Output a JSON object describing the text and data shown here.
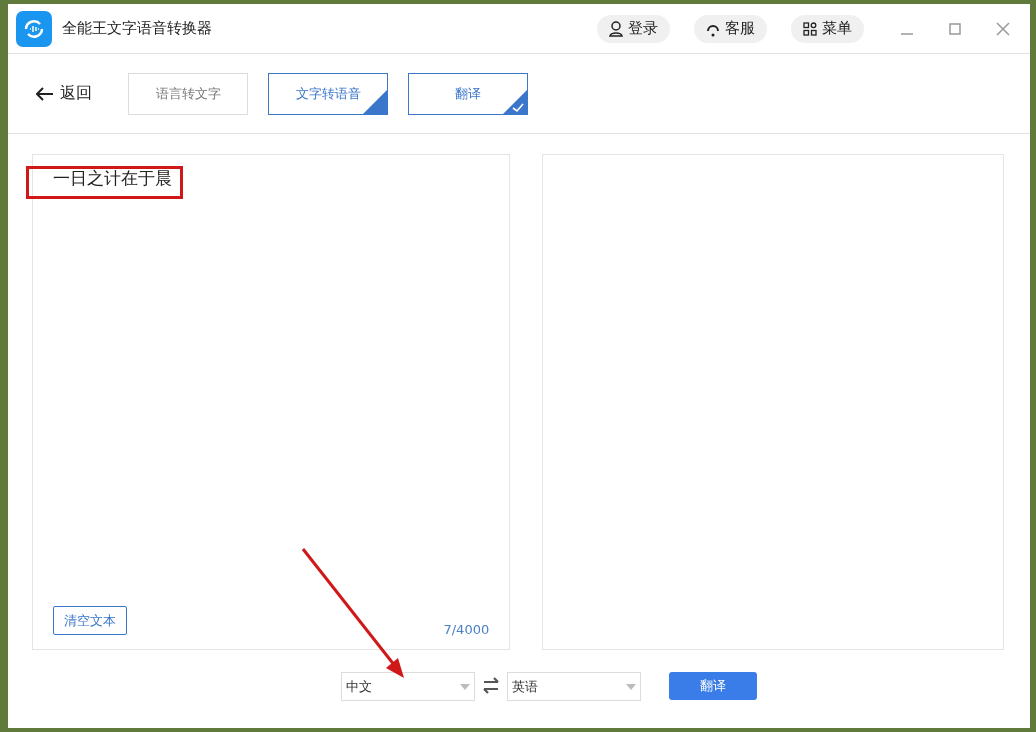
{
  "window": {
    "title": "全能王文字语音转换器"
  },
  "header_buttons": [
    {
      "kind": "user",
      "label": "登录"
    },
    {
      "kind": "headset",
      "label": "客服"
    },
    {
      "kind": "grid",
      "label": "菜单"
    }
  ],
  "back": {
    "label": "返回"
  },
  "tabs": [
    {
      "label": "语言转文字",
      "selected": false,
      "hover": false
    },
    {
      "label": "文字转语音",
      "selected": false,
      "hover": true
    },
    {
      "label": "翻译",
      "selected": true,
      "hover": false
    }
  ],
  "source": {
    "value": "一日之计在于晨",
    "clear_button": "清空文本",
    "count": "7/4000"
  },
  "language_from": {
    "value": "中文"
  },
  "language_to": {
    "value": "英语"
  },
  "translate_button": "翻译",
  "annotations": {
    "text_highlight_box": true,
    "arrow_to_language": true
  }
}
